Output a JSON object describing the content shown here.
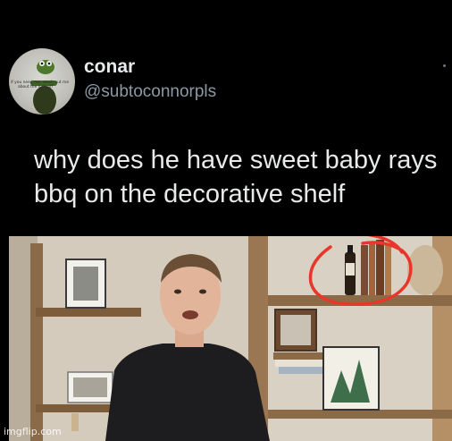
{
  "tweet": {
    "display_name": "conar",
    "handle": "@subtoconnorpls",
    "text": "why does he have sweet baby rays\nbbq on the decorative shelf",
    "avatar_caption": "if you need me, reach out me about the fuck off"
  },
  "photo": {
    "annotation_color": "#e8372a",
    "annotation": "red-circle-around-bbq-bottle"
  },
  "watermark": {
    "text": "imgflip.com"
  },
  "colors": {
    "background": "#000000",
    "name": "#e7e9ea",
    "handle": "#8b98a5"
  }
}
